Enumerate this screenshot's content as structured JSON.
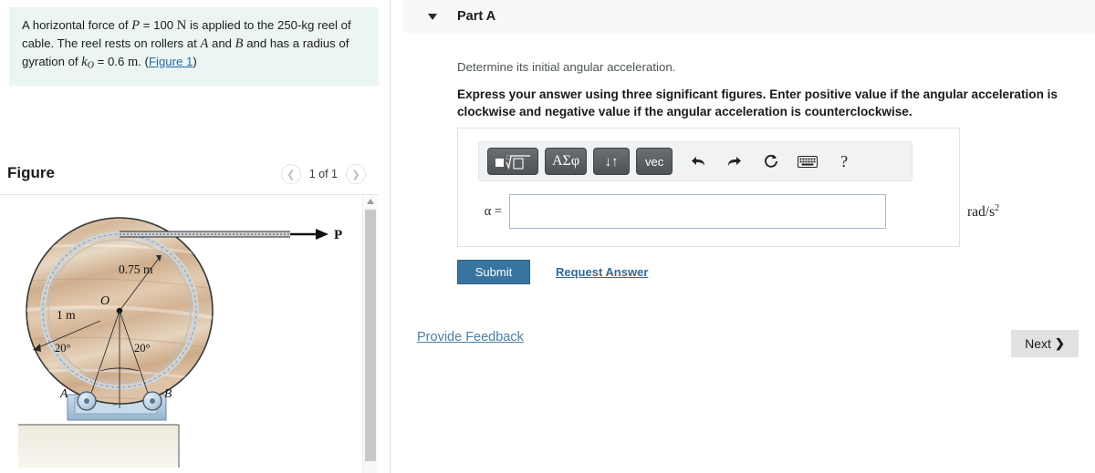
{
  "problem": {
    "text_part1": "A horizontal force of ",
    "var_P": "P",
    "eq1": " = 100 ",
    "unit_N": "N",
    "text_part2": " is applied to the 250-kg reel of cable. The reel rests on rollers at ",
    "var_A": "A",
    "and1": " and ",
    "var_B": "B",
    "text_part3": " and has a radius of gyration of ",
    "var_k": "k",
    "sub_O": "O",
    "eq2": " = 0.6 ",
    "unit_m": "m",
    "text_part4": ". (",
    "figure_link": "Figure 1",
    "text_part5": ")"
  },
  "figure": {
    "title": "Figure",
    "counter": "1 of 1",
    "prev_icon": "chevron-left-icon",
    "next_icon": "chevron-right-icon",
    "labels": {
      "force": "P",
      "outer_radius": "0.75 m",
      "center": "O",
      "inner_radius": "1 m",
      "angle_left": "20°",
      "angle_right": "20°",
      "roller_a": "A",
      "roller_b": "B"
    },
    "colors": {
      "wood_light": "#e3cdb4",
      "wood_mid": "#d2b294",
      "wood_dark": "#c4a184",
      "base_blue": "#afc8de",
      "base_blue_dark": "#8fabc4",
      "ground": "#e9e6d8"
    }
  },
  "part": {
    "label": "Part A",
    "caret_icon": "caret-down-icon",
    "prompt": "Determine its initial angular acceleration.",
    "instruction": "Express your answer using three significant figures. Enter positive value if the angular acceleration is clockwise and negative value if the angular acceleration is counterclockwise."
  },
  "toolbar": {
    "buttons": [
      {
        "name": "template-math-button",
        "label": "□ⁿ√□"
      },
      {
        "name": "greek-symbols-button",
        "label": "ΑΣφ"
      },
      {
        "name": "arrows-button",
        "label": "↓↑"
      },
      {
        "name": "vector-button",
        "label": "vec"
      }
    ],
    "icons": [
      {
        "name": "undo-icon",
        "label": "↰"
      },
      {
        "name": "redo-icon",
        "label": "↱"
      },
      {
        "name": "reset-icon",
        "label": "↻"
      },
      {
        "name": "keyboard-icon",
        "label": "⌨"
      },
      {
        "name": "help-icon",
        "label": "?"
      }
    ]
  },
  "answer": {
    "variable_label": "α =",
    "value": "",
    "placeholder": "",
    "unit_main": "rad/s",
    "unit_exp": "2"
  },
  "actions": {
    "submit": "Submit",
    "request_answer": "Request Answer",
    "provide_feedback": "Provide Feedback",
    "next": "Next",
    "next_icon": "chevron-right-icon"
  },
  "colors": {
    "problem_bg": "#eaf5f4",
    "submit_blue": "#37749f",
    "link_blue": "#2c6b9e",
    "header_gray": "#f7f8f8"
  }
}
